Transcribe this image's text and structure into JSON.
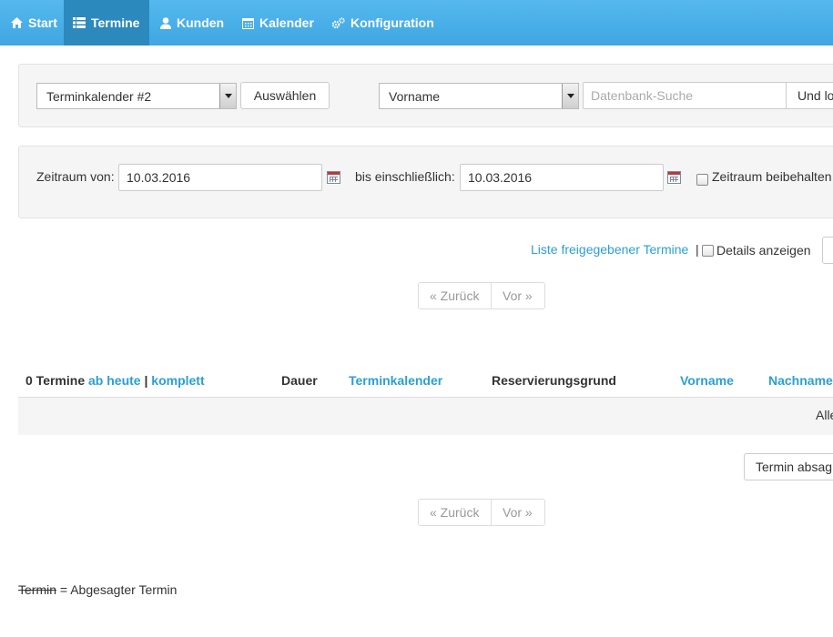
{
  "nav": {
    "items": [
      {
        "label": "Start",
        "icon": "home-icon"
      },
      {
        "label": "Termine",
        "icon": "list-icon",
        "active": true
      },
      {
        "label": "Kunden",
        "icon": "user-icon"
      },
      {
        "label": "Kalender",
        "icon": "calendar-icon"
      },
      {
        "label": "Konfiguration",
        "icon": "gears-icon"
      }
    ]
  },
  "search_panel": {
    "calendar_select": "Terminkalender #2",
    "select_button": "Auswählen",
    "field_select": "Vorname",
    "search_placeholder": "Datenbank-Suche",
    "search_button": "Und lo"
  },
  "date_panel": {
    "from_label": "Zeitraum von:",
    "from_value": "10.03.2016",
    "to_label": "bis einschließlich:",
    "to_value": "10.03.2016",
    "keep_label": "Zeitraum beibehalten"
  },
  "links": {
    "released_list": "Liste freigegebener Termine",
    "separator": "|",
    "details_label": "Details anzeigen"
  },
  "pagination": {
    "prev": "« Zurück",
    "next": "Vor »"
  },
  "table": {
    "count_label": "0 Termine",
    "from_today": "ab heute",
    "sep": "|",
    "complete": "komplett",
    "columns": [
      "Dauer",
      "Terminkalender",
      "Reservierungsgrund",
      "Vorname",
      "Nachname"
    ],
    "row_text": "Alle"
  },
  "cancel_button": "Termin absag",
  "legend": {
    "struck": "Termin",
    "text": "= Abgesagter Termin"
  },
  "colors": {
    "navbar": "#46aee8",
    "nav_active": "#2c89bd",
    "link": "#2a9fd6"
  }
}
